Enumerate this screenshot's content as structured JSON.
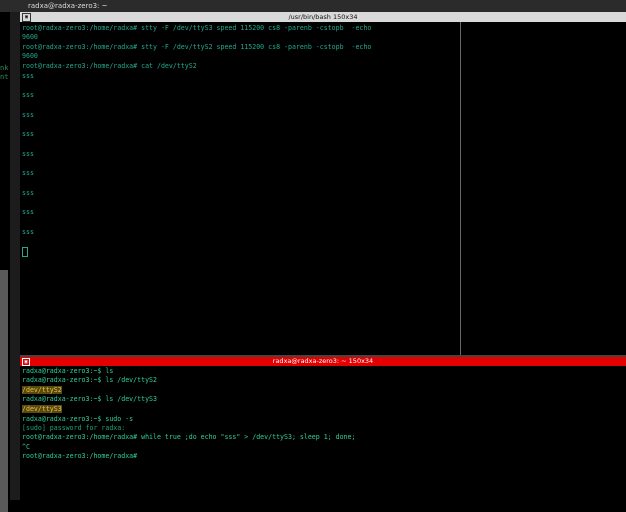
{
  "window": {
    "title": "radxa@radxa-zero3: ~"
  },
  "left_fragments": [
    "nk",
    "nt"
  ],
  "term1": {
    "title": "/usr/bin/bash 150x34",
    "lines": [
      "root@radxa-zero3:/home/radxa# stty -F /dev/ttyS3 speed 115200 cs8 -parenb -cstopb  -echo",
      "9600",
      "root@radxa-zero3:/home/radxa# stty -F /dev/ttyS2 speed 115200 cs8 -parenb -cstopb  -echo",
      "9600",
      "root@radxa-zero3:/home/radxa# cat /dev/ttyS2",
      "sss",
      "sss",
      "sss",
      "sss",
      "sss",
      "sss",
      "sss",
      "sss",
      "sss"
    ]
  },
  "term2": {
    "title": "radxa@radxa-zero3: ~ 150x34",
    "lines": [
      "radxa@radxa-zero3:~$ ls",
      "radxa@radxa-zero3:~$ ls /dev/ttyS2",
      "/dev/ttyS2",
      "radxa@radxa-zero3:~$ ls /dev/ttyS3",
      "/dev/ttyS3",
      "radxa@radxa-zero3:~$ sudo -s",
      "[sudo] password for radxa:",
      "root@radxa-zero3:/home/radxa# while true ;do echo \"sss\" > /dev/ttyS3; sleep 1; done;",
      "^C",
      "root@radxa-zero3:/home/radxa#"
    ]
  },
  "colors": {
    "terminal_text": "#23a98e",
    "active_header": "#e30000",
    "inactive_header": "#d9d9d9"
  }
}
